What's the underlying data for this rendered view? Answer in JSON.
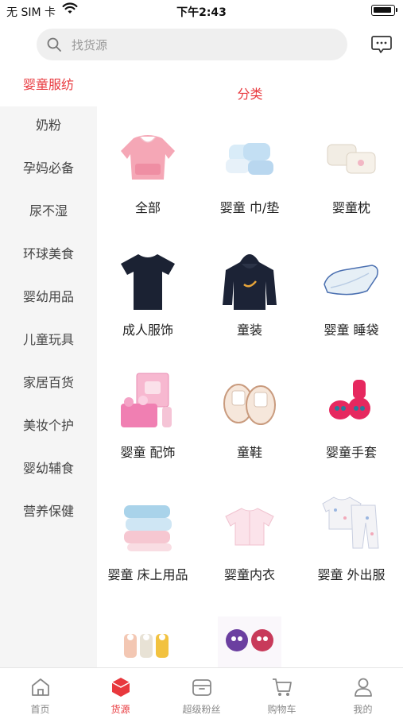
{
  "status_bar": {
    "carrier": "无 SIM 卡",
    "time": "下午2:43"
  },
  "search": {
    "placeholder": "找货源"
  },
  "colors": {
    "accent": "#e8383d",
    "sidebar_bg": "#f5f5f5"
  },
  "sidebar": {
    "items": [
      {
        "label": "婴童服纺",
        "active": true
      },
      {
        "label": "奶粉"
      },
      {
        "label": "孕妈必备"
      },
      {
        "label": "尿不湿"
      },
      {
        "label": "环球美食"
      },
      {
        "label": "婴幼用品"
      },
      {
        "label": "儿童玩具"
      },
      {
        "label": "家居百货"
      },
      {
        "label": "美妆个护"
      },
      {
        "label": "婴幼辅食"
      },
      {
        "label": "营养保健"
      }
    ]
  },
  "main": {
    "title": "分类",
    "categories": [
      {
        "label": "全部",
        "icon": "bib-image"
      },
      {
        "label": "婴童 巾/垫",
        "icon": "towels-image"
      },
      {
        "label": "婴童枕",
        "icon": "pillow-image"
      },
      {
        "label": "成人服饰",
        "icon": "tshirt-image"
      },
      {
        "label": "童装",
        "icon": "hoodie-image"
      },
      {
        "label": "婴童 睡袋",
        "icon": "sleeping-bag-image"
      },
      {
        "label": "婴童 配饰",
        "icon": "gift-box-image"
      },
      {
        "label": "童鞋",
        "icon": "slippers-image"
      },
      {
        "label": "婴童手套",
        "icon": "mittens-image"
      },
      {
        "label": "婴童  床上用品",
        "icon": "blankets-image"
      },
      {
        "label": "婴童内衣",
        "icon": "baby-top-image"
      },
      {
        "label": "婴童 外出服",
        "icon": "pajama-image"
      },
      {
        "label": "",
        "icon": "socks-image"
      },
      {
        "label": "",
        "icon": "bibs-image"
      }
    ]
  },
  "tabbar": {
    "items": [
      {
        "label": "首页",
        "icon": "home-icon"
      },
      {
        "label": "货源",
        "icon": "cube-icon",
        "active": true
      },
      {
        "label": "超级粉丝",
        "icon": "box-icon"
      },
      {
        "label": "购物车",
        "icon": "cart-icon"
      },
      {
        "label": "我的",
        "icon": "user-icon"
      }
    ]
  }
}
